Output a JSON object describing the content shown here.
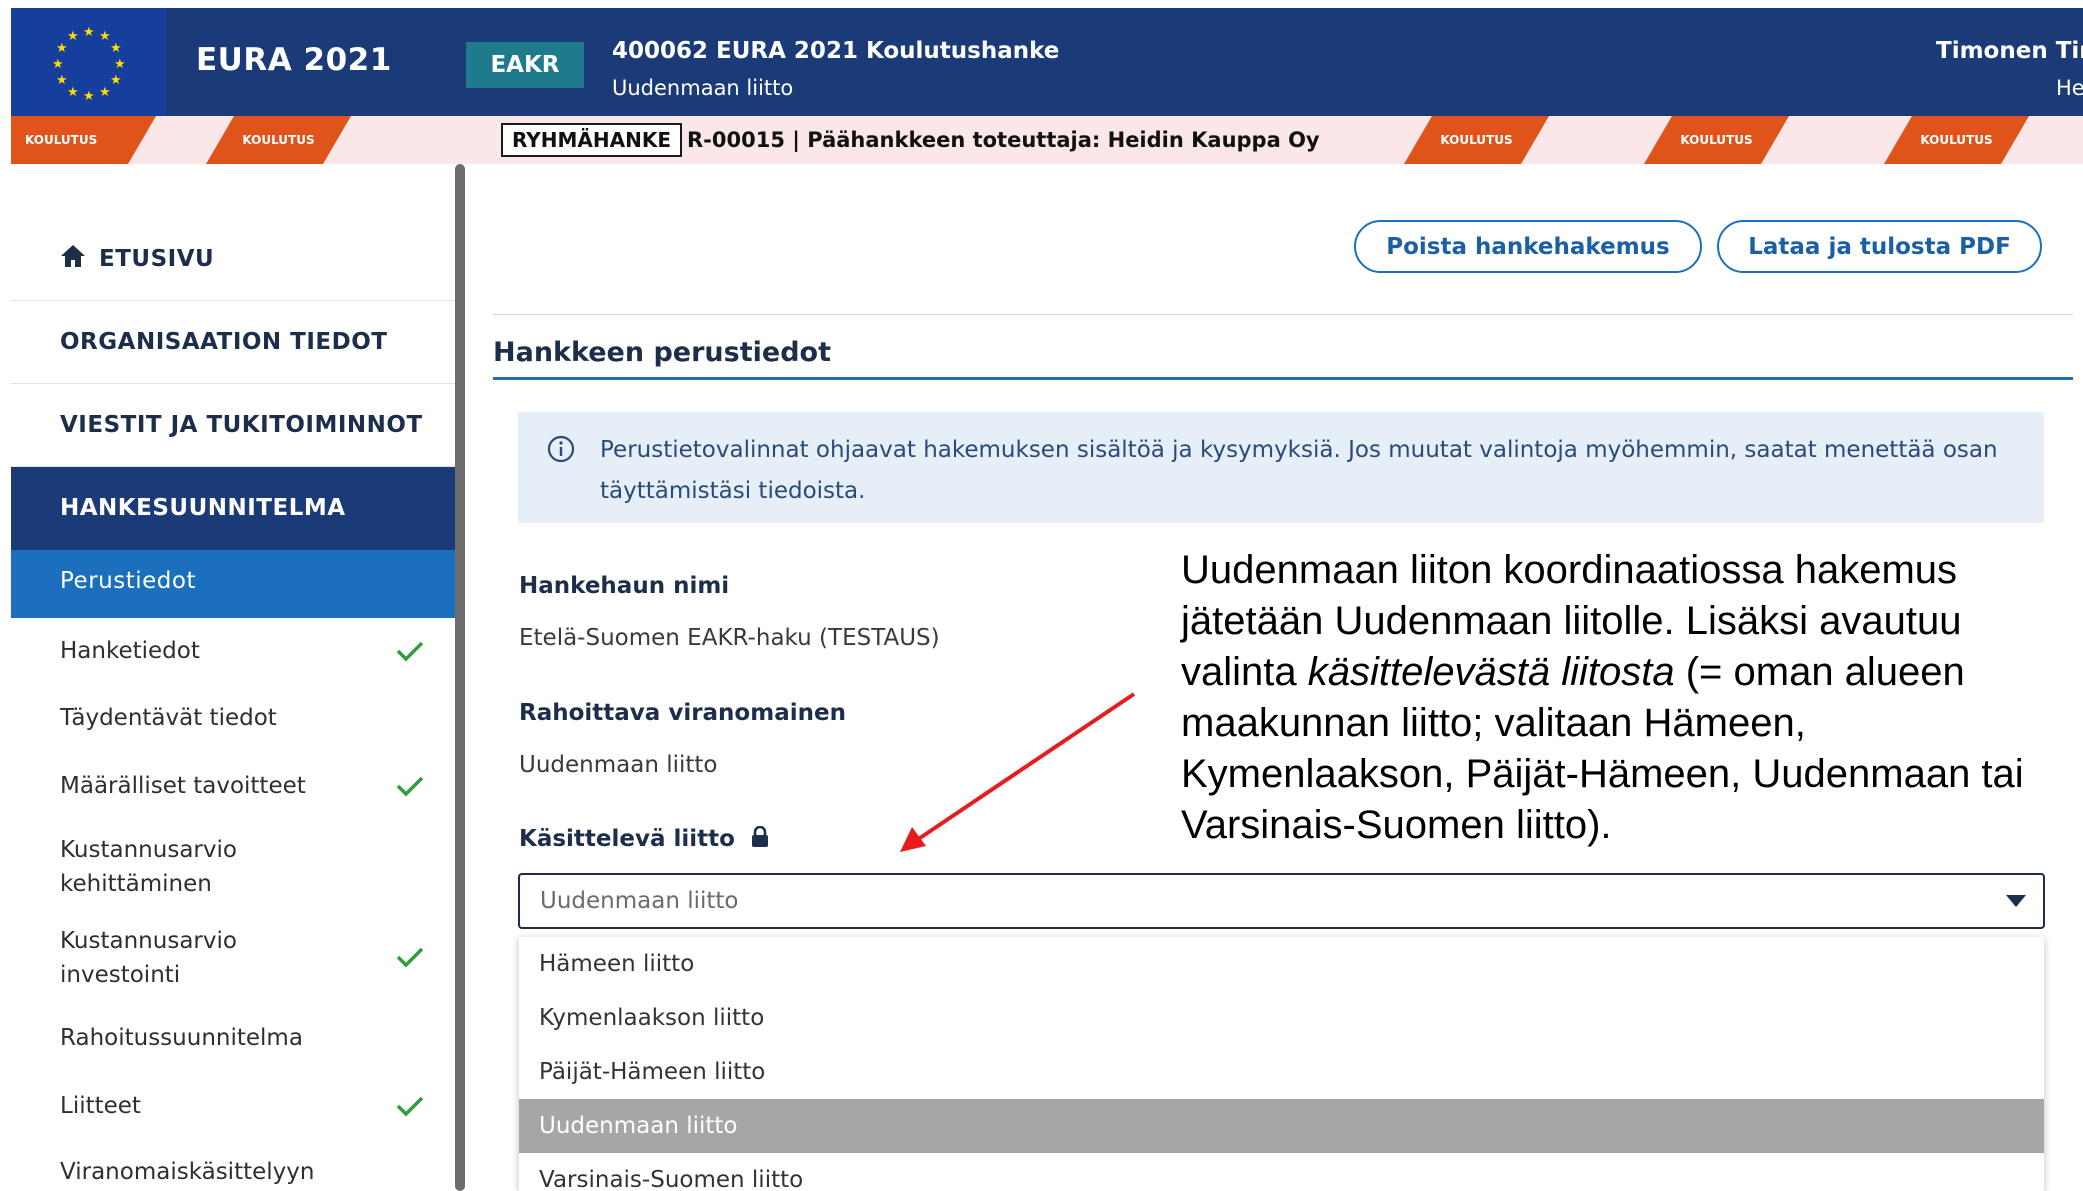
{
  "header": {
    "brand": "EURA 2021",
    "fund_badge": "EAKR",
    "project_title": "400062 EURA 2021 Koulutushanke",
    "project_org": "Uudenmaan liitto",
    "user_name": "Timonen Tin",
    "user_org": "He"
  },
  "stripe": {
    "ribbon_text": "KOULUTUS",
    "group_badge": "RYHMÄHANKE",
    "group_info": "R-00015 | Päähankkeen toteuttaja: Heidin Kauppa Oy"
  },
  "sidebar": {
    "home": "ETUSIVU",
    "organisation": "ORGANISAATION TIEDOT",
    "messages": "VIESTIT JA TUKITOIMINNOT",
    "plan": "HANKESUUNNITELMA",
    "items": [
      {
        "label": "Perustiedot",
        "done": false
      },
      {
        "label": "Hanketiedot",
        "done": true
      },
      {
        "label": "Täydentävät tiedot",
        "done": false
      },
      {
        "label": "Määrälliset tavoitteet",
        "done": true
      },
      {
        "label": "Kustannusarvio kehittäminen",
        "done": false
      },
      {
        "label": "Kustannusarvio investointi",
        "done": true
      },
      {
        "label": "Rahoitussuunnitelma",
        "done": false
      },
      {
        "label": "Liitteet",
        "done": true
      },
      {
        "label": "Viranomaiskäsittelyyn",
        "done": false
      }
    ]
  },
  "toolbar": {
    "delete_label": "Poista hankehakemus",
    "pdf_label": "Lataa ja tulosta PDF"
  },
  "section": {
    "title": "Hankkeen perustiedot",
    "info": "Perustietovalinnat ohjaavat hakemuksen sisältöä ja kysymyksiä. Jos muutat valintoja myöhemmin, saatat menettää osan täyttämistäsi tiedoista."
  },
  "fields": {
    "call_label": "Hankehaun nimi",
    "call_value": "Etelä-Suomen EAKR-haku (TESTAUS)",
    "authority_label": "Rahoittava viranomainen",
    "authority_value": "Uudenmaan liitto",
    "handler_label": "Käsittelevä liitto",
    "handler_value": "Uudenmaan liitto"
  },
  "dropdown": {
    "options": [
      "Hämeen liitto",
      "Kymenlaakson liitto",
      "Päijät-Hämeen liitto",
      "Uudenmaan liitto",
      "Varsinais-Suomen liitto"
    ],
    "selected": "Uudenmaan liitto"
  },
  "annotation": {
    "part1": "Uudenmaan liiton koordinaatiossa hakemus jätetään Uudenmaan liitolle. Lisäksi avautuu valinta ",
    "italic": "käsittelevästä liitosta",
    "part2": " (= oman alueen maakunnan liitto; valitaan Hämeen, Kymenlaakson, Päijät-Hämeen, Uudenmaan tai Varsinais-Suomen liitto).",
    "arrow_color": "#e81c1c"
  },
  "colors": {
    "header_bg": "#1a3a78",
    "accent": "#1b6fbd",
    "ribbon": "#e0541c",
    "check": "#2e9e3e"
  }
}
